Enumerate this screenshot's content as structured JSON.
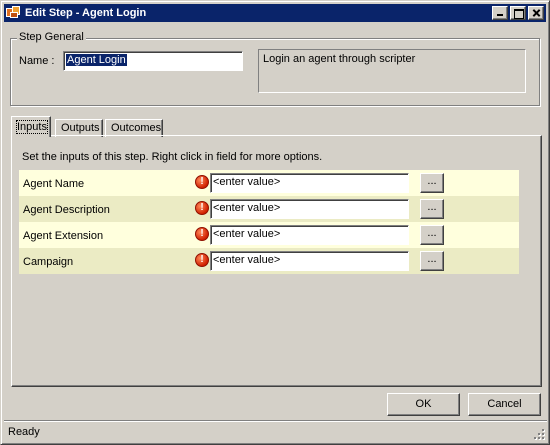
{
  "window": {
    "title": "Edit Step - Agent Login",
    "icon": "scripter-app-icon"
  },
  "step_general": {
    "group_title": "Step General",
    "name_label": "Name :",
    "name_value": "Agent Login",
    "description": "Login an agent through scripter"
  },
  "tabs": [
    {
      "label": "Inputs",
      "active": true
    },
    {
      "label": "Outputs",
      "active": false
    },
    {
      "label": "Outcomes",
      "active": false
    }
  ],
  "inputs": {
    "instruction": "Set the inputs of this step.  Right click in field for more options.",
    "rows": [
      {
        "label": "Agent Name",
        "value": "<enter value>",
        "status_icon": "error-icon",
        "browse": "..."
      },
      {
        "label": "Agent Description",
        "value": "<enter value>",
        "status_icon": "error-icon",
        "browse": "..."
      },
      {
        "label": "Agent Extension",
        "value": "<enter value>",
        "status_icon": "error-icon",
        "browse": "..."
      },
      {
        "label": "Campaign",
        "value": "<enter value>",
        "status_icon": "error-icon",
        "browse": "..."
      }
    ]
  },
  "buttons": {
    "ok": "OK",
    "cancel": "Cancel"
  },
  "status": {
    "text": "Ready"
  },
  "colors": {
    "title_bar": "#0a246a",
    "row_light": "#ffffdd",
    "row_dark": "#ebebc4",
    "error": "#d02000"
  }
}
